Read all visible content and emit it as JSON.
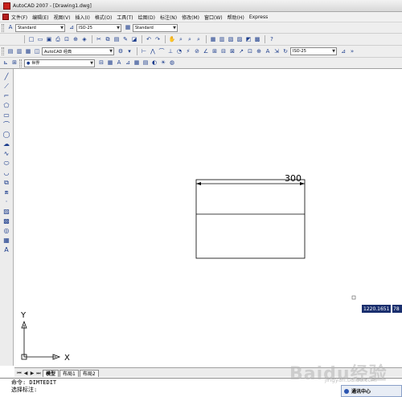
{
  "window": {
    "title": "AutoCAD 2007 - [Drawing1.dwg]"
  },
  "menubar": {
    "items": [
      "文件(F)",
      "编辑(E)",
      "视图(V)",
      "插入(I)",
      "格式(O)",
      "工具(T)",
      "绘图(D)",
      "标注(N)",
      "修改(M)",
      "窗口(W)",
      "帮助(H)",
      "Express"
    ]
  },
  "toolbar": {
    "text_style": "Standard",
    "dim_style": "ISO-25",
    "table_style": "Standard",
    "workspace": "AutoCAD 经典",
    "dim_style_right": "ISO-25",
    "ucs_label": "世界"
  },
  "drawing": {
    "dimension_text": "300"
  },
  "ucs": {
    "x_label": "X",
    "y_label": "Y"
  },
  "coordinate_readout": {
    "value": "1220.1651",
    "extra": "78"
  },
  "layout_tabs": [
    "模型",
    "布局1",
    "布局2"
  ],
  "command_line": {
    "line1": "命令: DIMTEDIT",
    "line2": "选择标注:"
  },
  "comm_center": {
    "label": "通讯中心"
  },
  "watermark": {
    "text": "Baidu经验",
    "sub": "jingyan.baidu.com"
  },
  "icons": {
    "accent": "#1b3c8c",
    "readout_bg": "#1a2f6e",
    "app_icon_color": "#c8201c"
  }
}
